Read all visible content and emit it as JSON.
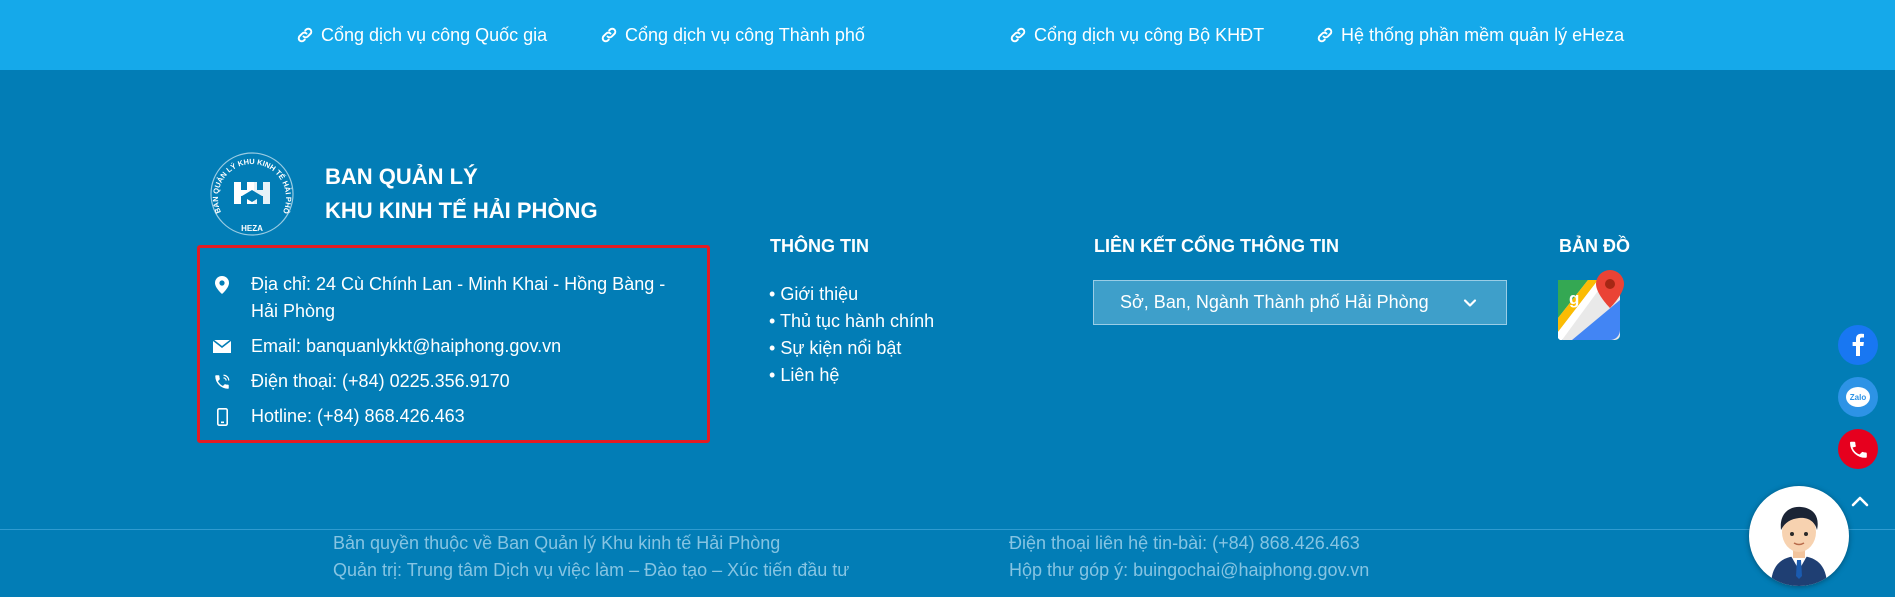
{
  "top_links": [
    {
      "label": "Cổng dịch vụ công Quốc gia",
      "icon": "link-icon"
    },
    {
      "label": "Cổng dịch vụ công Thành phố",
      "icon": "link-icon"
    },
    {
      "label": "Cổng dịch vụ công Bộ KHĐT",
      "icon": "link-icon"
    },
    {
      "label": "Hệ thống phần mềm quản lý eHeza",
      "icon": "link-icon"
    }
  ],
  "org": {
    "line1": "BAN QUẢN LÝ",
    "line2": "KHU KINH TẾ HẢI PHÒNG",
    "logo_ring_text": "BAN QUẢN LÝ KHU KINH TẾ HẢI PHÒNG",
    "logo_bottom_text": "HEZA"
  },
  "contact": {
    "address": "Địa chỉ: 24 Cù Chính Lan - Minh Khai - Hồng Bàng - Hải Phòng",
    "email": "Email: banquanlykkt@haiphong.gov.vn",
    "phone": "Điện thoại: (+84) 0225.356.9170",
    "hotline": "Hotline: (+84) 868.426.463"
  },
  "info": {
    "heading": "THÔNG TIN",
    "items": [
      "Giới thiệu",
      "Thủ tục hành chính",
      "Sự kiện nổi bật",
      "Liên hệ"
    ]
  },
  "links": {
    "heading": "LIÊN KẾT CỔNG THÔNG TIN",
    "selected": "Sở, Ban, Ngành Thành phố Hải Phòng"
  },
  "map": {
    "heading": "BẢN ĐỒ",
    "icon": "google-maps-icon"
  },
  "footer": {
    "copyright": "Bản quyền thuộc về Ban Quản lý Khu kinh tế Hải Phòng",
    "admin": "Quản trị: Trung tâm Dịch vụ việc làm – Đào tạo – Xúc tiến đầu tư",
    "contact_phone": "Điện thoại liên hệ tin-bài: (+84) 868.426.463",
    "mailbox": "Hộp thư góp ý:  buingochai@haiphong.gov.vn"
  },
  "floating": {
    "zalo_label": "Zalo",
    "icons": [
      "facebook-icon",
      "zalo-icon",
      "phone-icon",
      "chevron-up-icon",
      "support-avatar"
    ]
  },
  "colors": {
    "top_bar": "#15a9ea",
    "footer_bg": "#027db6",
    "highlight_border": "#e31b23",
    "muted_text": "#86c4e2"
  }
}
